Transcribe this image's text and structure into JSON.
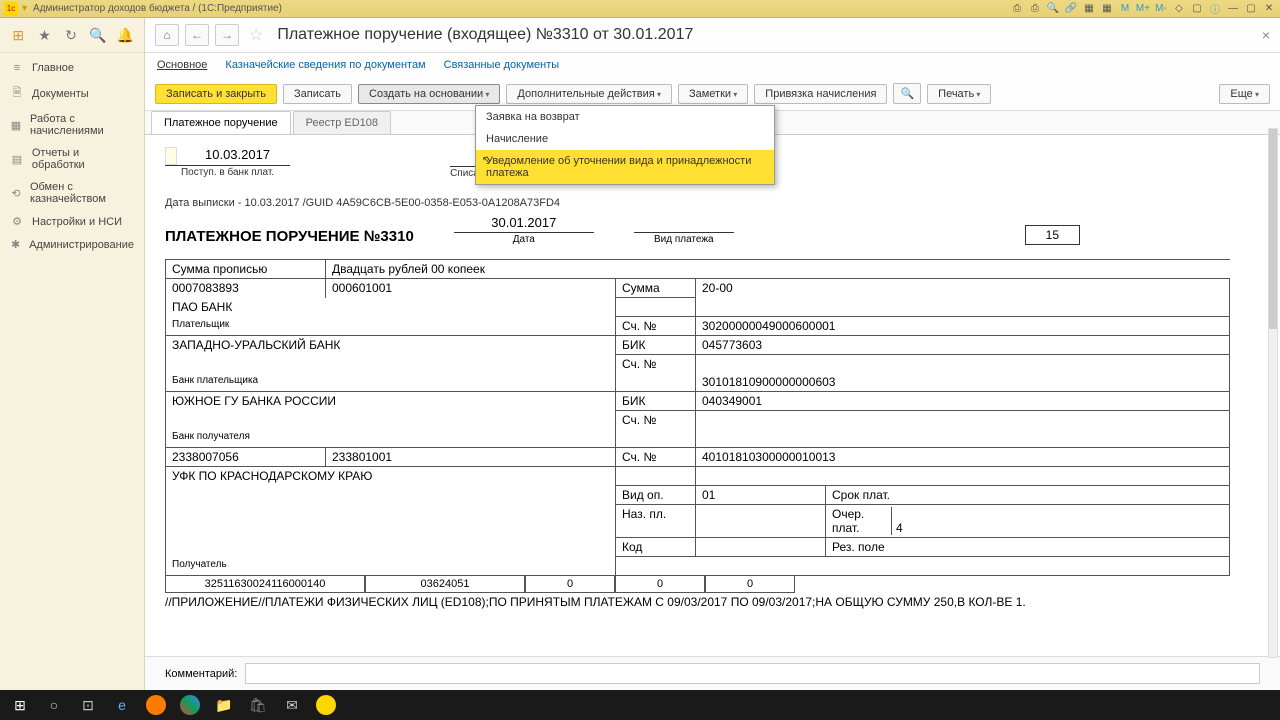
{
  "titlebar": {
    "app": "Администратор доходов бюджета",
    "suffix": "(1С:Предприятие)"
  },
  "sidebar": {
    "items": [
      {
        "icon": "≡",
        "label": "Главное"
      },
      {
        "icon": "🗎",
        "label": "Документы"
      },
      {
        "icon": "▦",
        "label": "Работа с начислениями"
      },
      {
        "icon": "▤",
        "label": "Отчеты и обработки"
      },
      {
        "icon": "⟲",
        "label": "Обмен с казначейством"
      },
      {
        "icon": "⚙",
        "label": "Настройки и НСИ"
      },
      {
        "icon": "✱",
        "label": "Администрирование"
      }
    ]
  },
  "doc": {
    "title": "Платежное поручение (входящее) №3310 от 30.01.2017",
    "links": [
      "Основное",
      "Казначейские сведения по документам",
      "Связанные документы"
    ]
  },
  "toolbar": {
    "save_close": "Записать и закрыть",
    "save": "Записать",
    "create_based": "Создать на основании",
    "extra": "Дополнительные действия",
    "notes": "Заметки",
    "link": "Привязка начисления",
    "print": "Печать",
    "more": "Еще"
  },
  "dropdown": {
    "items": [
      "Заявка на возврат",
      "Начисление",
      "Уведомление об уточнении вида и принадлежности платежа"
    ]
  },
  "tabs": [
    "Платежное поручение",
    "Реестр ED108"
  ],
  "form": {
    "date_in": "10.03.2017",
    "date_in_lbl": "Поступ. в банк плат.",
    "date_off_lbl": "Списано со сч. плат.",
    "guid": "Дата выписки - 10.03.2017 /GUID 4A59C6CB-5E00-0358-E053-0A1208A73FD4",
    "po_title": "ПЛАТЕЖНОЕ ПОРУЧЕНИЕ №3310",
    "po_date": "30.01.2017",
    "po_date_lbl": "Дата",
    "pay_type_lbl": "Вид платежа",
    "box15": "15",
    "sum_words_lbl": "Сумма прописью",
    "sum_words": "Двадцать рублей 00 копеек",
    "inn": "0007083893",
    "kpp": "000601001",
    "sum_lbl": "Сумма",
    "sum_val": "20-00",
    "bank1": "ПАО БАНК",
    "acct_lbl": "Сч. №",
    "acct1": "30200000049000600001",
    "payer_lbl": "Плательщик",
    "bank2": "ЗАПАДНО-УРАЛЬСКИЙ БАНК",
    "bik_lbl": "БИК",
    "bik1": "045773603",
    "acct2": "30101810900000000603",
    "bank_payer_lbl": "Банк плательщика",
    "bank3": "ЮЖНОЕ ГУ БАНКА РОССИИ",
    "bik2": "040349001",
    "bank_recv_lbl": "Банк получателя",
    "inn2": "2338007056",
    "kpp2": "233801001",
    "acct3": "40101810300000010013",
    "recv": "УФК ПО КРАСНОДАРСКОМУ КРАЮ",
    "vid_op_lbl": "Вид оп.",
    "vid_op": "01",
    "srok_lbl": "Срок плат.",
    "naz_pl_lbl": "Наз. пл.",
    "ocher_lbl": "Очер. плат.",
    "ocher": "4",
    "kod_lbl": "Код",
    "rez_lbl": "Рез. поле",
    "recv_lbl": "Получатель",
    "codes": [
      "32511630024116000140",
      "03624051",
      "0",
      "0",
      "0"
    ],
    "note": "//ПРИЛОЖЕНИЕ//ПЛАТЕЖИ ФИЗИЧЕСКИХ ЛИЦ (ED108);ПО ПРИНЯТЫМ ПЛАТЕЖАМ С 09/03/2017 ПО 09/03/2017;НА ОБЩУЮ СУММУ 250,В КОЛ-ВЕ 1.",
    "comment_lbl": "Комментарий:"
  }
}
